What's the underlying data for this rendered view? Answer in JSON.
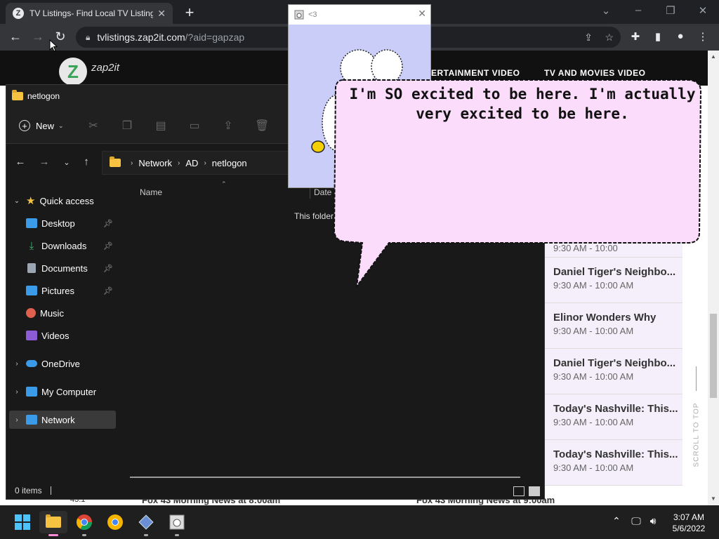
{
  "browser": {
    "tab_title": "TV Listings- Find Local TV Listings",
    "tab_favicon": "Z",
    "url_host": "tvlistings.zap2it.com",
    "url_path": "/?aid=gapzap"
  },
  "site": {
    "logo_letter": "Z",
    "logo_text": "zap2it",
    "nav_items": [
      "ERTAINMENT VIDEO",
      "TV AND MOVIES VIDEO"
    ],
    "listing_top_partial": "9:30 AM - 10:00",
    "listings": [
      {
        "show": "Daniel Tiger's Neighbo...",
        "time": "9:30 AM - 10:00 AM"
      },
      {
        "show": "Elinor Wonders Why",
        "time": "9:30 AM - 10:00 AM"
      },
      {
        "show": "Daniel Tiger's Neighbo...",
        "time": "9:30 AM - 10:00 AM"
      },
      {
        "show": "Today's Nashville: This...",
        "time": "9:30 AM - 10:00 AM"
      },
      {
        "show": "Today's Nashville: This...",
        "time": "9:30 AM - 10:00 AM"
      }
    ],
    "scroll_to_top": "SCROLL TO TOP",
    "bottom_channel": "43.1",
    "bottom_show_1": "Fox 43 Morning News at 8:00am",
    "bottom_show_2": "Fox 43 Morning News at 9:00am"
  },
  "explorer": {
    "title": "netlogon",
    "new_label": "New",
    "breadcrumb": [
      "Network",
      "AD",
      "netlogon"
    ],
    "nav": [
      {
        "label": "Quick access",
        "icon": "star-icon",
        "color": "#f5c242"
      },
      {
        "label": "Desktop",
        "icon": "desktop-icon",
        "color": "#3b9be8"
      },
      {
        "label": "Downloads",
        "icon": "download-icon",
        "color": "#3fb56d"
      },
      {
        "label": "Documents",
        "icon": "documents-icon",
        "color": "#9aa6b2"
      },
      {
        "label": "Pictures",
        "icon": "pictures-icon",
        "color": "#3b9be8"
      },
      {
        "label": "Music",
        "icon": "music-icon",
        "color": "#e0604f"
      },
      {
        "label": "Videos",
        "icon": "videos-icon",
        "color": "#8b5cd6"
      },
      {
        "label": "OneDrive",
        "icon": "onedrive-icon",
        "color": "#3b9be8"
      },
      {
        "label": "My Computer",
        "icon": "computer-icon",
        "color": "#3b9be8"
      },
      {
        "label": "Network",
        "icon": "network-icon",
        "color": "#3b9be8"
      }
    ],
    "col_name": "Name",
    "col_date": "Date",
    "empty_message": "This folder",
    "status": "0 items"
  },
  "popup": {
    "title": "<3"
  },
  "bubble": {
    "text": "I'm SO excited to be here. I'm actually very excited to be here."
  },
  "taskbar": {
    "time": "3:07 AM",
    "date": "5/6/2022"
  }
}
